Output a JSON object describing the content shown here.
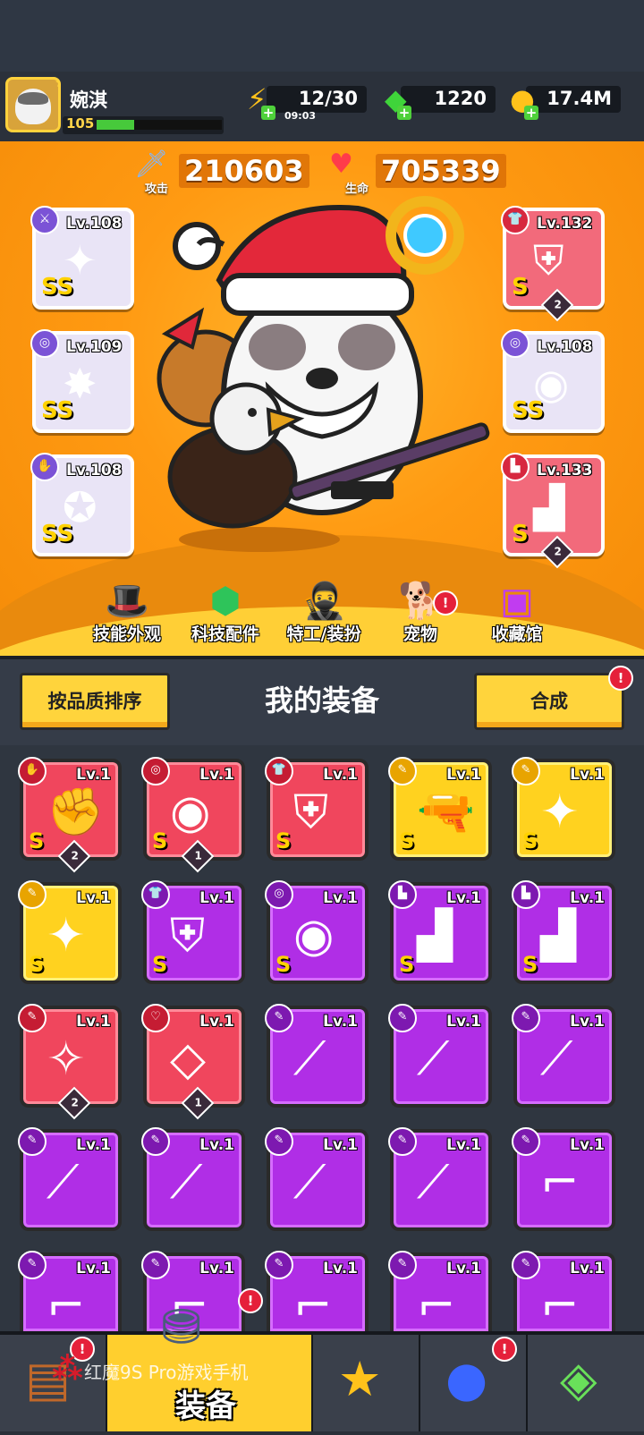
{
  "player": {
    "name": "婉淇",
    "level": "105",
    "xp_fraction": 0.3
  },
  "resources": {
    "energy": {
      "value": "12/30",
      "timer": "09:03",
      "icon": "lightning-icon"
    },
    "gems": {
      "value": "1220",
      "icon": "gem-icon"
    },
    "coins": {
      "value": "17.4M",
      "icon": "coin-icon"
    }
  },
  "stats": {
    "attack": {
      "label": "攻击",
      "value": "210603"
    },
    "hp": {
      "label": "生命",
      "value": "705339"
    }
  },
  "equipped_left": [
    {
      "lv": "Lv.108",
      "grade": "SS",
      "icon": "staff-icon"
    },
    {
      "lv": "Lv.109",
      "grade": "SS",
      "icon": "ring-icon"
    },
    {
      "lv": "Lv.108",
      "grade": "SS",
      "icon": "gauntlet-icon"
    }
  ],
  "equipped_right": [
    {
      "lv": "Lv.132",
      "grade": "S",
      "badge": "2",
      "icon": "armor-icon"
    },
    {
      "lv": "Lv.108",
      "grade": "SS",
      "icon": "belt-icon"
    },
    {
      "lv": "Lv.133",
      "grade": "S",
      "badge": "2",
      "icon": "boots-icon"
    }
  ],
  "hero_menu": [
    {
      "label": "技能外观",
      "icon": "skill-skin-icon"
    },
    {
      "label": "科技配件",
      "icon": "tech-part-icon"
    },
    {
      "label": "特工/装扮",
      "icon": "agent-icon"
    },
    {
      "label": "宠物",
      "icon": "pet-icon",
      "alert": "!"
    },
    {
      "label": "收藏馆",
      "icon": "collection-icon"
    }
  ],
  "panel": {
    "sort_label": "按品质排序",
    "title": "我的装备",
    "merge_label": "合成",
    "merge_alert": "!"
  },
  "inventory_rows": [
    [
      {
        "rarity": "red",
        "lv": "Lv.1",
        "grade": "S",
        "badge": "2",
        "icon": "gauntlet-icon"
      },
      {
        "rarity": "red",
        "lv": "Lv.1",
        "grade": "S",
        "badge": "1",
        "icon": "belt-icon"
      },
      {
        "rarity": "red",
        "lv": "Lv.1",
        "grade": "S",
        "icon": "armor-icon"
      },
      {
        "rarity": "yel",
        "lv": "Lv.1",
        "grade": "S",
        "icon": "water-gun-icon"
      },
      {
        "rarity": "yel",
        "lv": "Lv.1",
        "grade": "S",
        "icon": "sword-icon"
      }
    ],
    [
      {
        "rarity": "yel",
        "lv": "Lv.1",
        "grade": "S",
        "icon": "sword-icon"
      },
      {
        "rarity": "pur",
        "lv": "Lv.1",
        "grade": "S",
        "icon": "armor-icon"
      },
      {
        "rarity": "pur",
        "lv": "Lv.1",
        "grade": "S",
        "icon": "belt-icon"
      },
      {
        "rarity": "pur",
        "lv": "Lv.1",
        "grade": "S",
        "icon": "boots-icon"
      },
      {
        "rarity": "pur",
        "lv": "Lv.1",
        "grade": "S",
        "icon": "boots-icon"
      }
    ],
    [
      {
        "rarity": "red",
        "lv": "Lv.1",
        "badge": "2",
        "icon": "kunai-icon"
      },
      {
        "rarity": "red",
        "lv": "Lv.1",
        "badge": "1",
        "icon": "necklace-icon"
      },
      {
        "rarity": "pur",
        "lv": "Lv.1",
        "icon": "scimitar-icon"
      },
      {
        "rarity": "pur",
        "lv": "Lv.1",
        "icon": "scimitar-icon"
      },
      {
        "rarity": "pur",
        "lv": "Lv.1",
        "icon": "scimitar-icon"
      }
    ],
    [
      {
        "rarity": "pur",
        "lv": "Lv.1",
        "icon": "scimitar-icon"
      },
      {
        "rarity": "pur",
        "lv": "Lv.1",
        "icon": "scimitar-icon"
      },
      {
        "rarity": "pur",
        "lv": "Lv.1",
        "icon": "scimitar-icon"
      },
      {
        "rarity": "pur",
        "lv": "Lv.1",
        "icon": "scimitar-icon"
      },
      {
        "rarity": "pur",
        "lv": "Lv.1",
        "icon": "revolver-icon"
      }
    ],
    [
      {
        "rarity": "pur",
        "lv": "Lv.1",
        "icon": "revolver-icon"
      },
      {
        "rarity": "pur",
        "lv": "Lv.1",
        "icon": "revolver-icon"
      },
      {
        "rarity": "pur",
        "lv": "Lv.1",
        "icon": "revolver-icon"
      },
      {
        "rarity": "pur",
        "lv": "Lv.1",
        "icon": "revolver-icon"
      },
      {
        "rarity": "pur",
        "lv": "Lv.1",
        "icon": "revolver-icon"
      }
    ]
  ],
  "bottom_nav": {
    "active_label": "装备",
    "watermark": "红魔9S Pro游戏手机",
    "tabs": [
      "shop-tab",
      "equipment-tab",
      "hero-tab",
      "planet-tab",
      "gene-tab"
    ]
  },
  "colors": {
    "hero_bg": "#ff9a12",
    "red_rarity": "#f0465d",
    "yellow_rarity": "#ffd21f",
    "purple_rarity": "#b02ee6"
  }
}
